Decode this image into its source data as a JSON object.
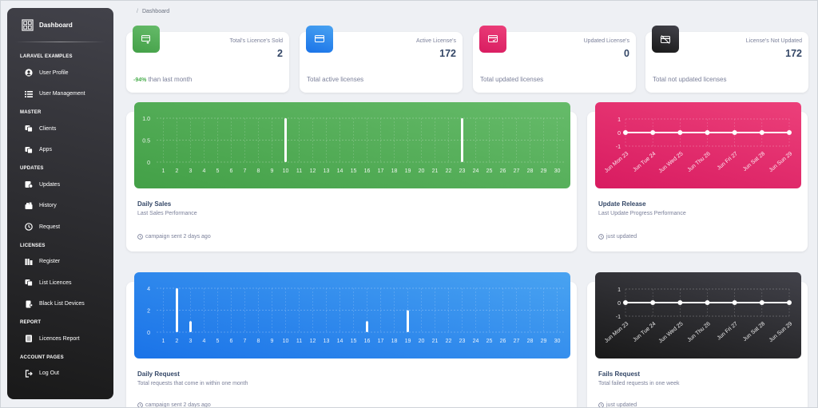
{
  "sidebar": {
    "brand": "Dashboard",
    "sections": [
      {
        "title": "LARAVEL EXAMPLES",
        "items": [
          {
            "label": "User Profile",
            "icon": "user-circle-icon"
          },
          {
            "label": "User Management",
            "icon": "list-icon"
          }
        ]
      },
      {
        "title": "MASTER",
        "items": [
          {
            "label": "Clients",
            "icon": "clients-icon"
          },
          {
            "label": "Apps",
            "icon": "apps-icon"
          }
        ]
      },
      {
        "title": "UPDATES",
        "items": [
          {
            "label": "Updates",
            "icon": "updates-icon"
          },
          {
            "label": "History",
            "icon": "history-icon"
          },
          {
            "label": "Request",
            "icon": "clock-icon"
          }
        ]
      },
      {
        "title": "LICENSES",
        "items": [
          {
            "label": "Register",
            "icon": "register-icon"
          },
          {
            "label": "List Licences",
            "icon": "list-licences-icon"
          },
          {
            "label": "Black List Devices",
            "icon": "blacklist-device-icon"
          }
        ]
      },
      {
        "title": "REPORT",
        "items": [
          {
            "label": "Licences Report",
            "icon": "report-icon"
          }
        ]
      },
      {
        "title": "ACCOUNT PAGES",
        "items": [
          {
            "label": "Log Out",
            "icon": "logout-icon"
          }
        ]
      }
    ]
  },
  "breadcrumb": {
    "separator": "/",
    "current": "Dashboard"
  },
  "stats": [
    {
      "label": "Total's Licence's Sold",
      "value": "2",
      "foot_strong": "-94%",
      "foot": " than last month",
      "color": "#4caf50",
      "icon": "license-add-icon"
    },
    {
      "label": "Active License's",
      "value": "172",
      "foot_strong": "",
      "foot": "Total active licenses",
      "color": "#1a73e8",
      "icon": "card-icon"
    },
    {
      "label": "Updated License's",
      "value": "0",
      "foot_strong": "",
      "foot": "Total updated licenses",
      "color": "#e91e63",
      "icon": "card-check-icon"
    },
    {
      "label": "License's Not Updated",
      "value": "172",
      "foot_strong": "",
      "foot": "Total not updated licenses",
      "color": "#262626",
      "icon": "card-off-icon"
    }
  ],
  "cards": {
    "daily_sales": {
      "title": "Daily Sales",
      "subtitle": "Last Sales Performance",
      "foot": "campaign sent 2 days ago"
    },
    "update_release": {
      "title": "Update Release",
      "subtitle": "Last Update Progress Performance",
      "foot": "just updated"
    },
    "daily_request": {
      "title": "Daily Request",
      "subtitle": "Total requests that come in within one month",
      "foot": "campaign sent 2 days ago"
    },
    "fails_request": {
      "title": "Fails Request",
      "subtitle": "Total failed requests in one week",
      "foot": "just updated"
    }
  },
  "chart_data": [
    {
      "id": "daily_sales",
      "type": "bar",
      "categories": [
        "1",
        "2",
        "3",
        "4",
        "5",
        "6",
        "7",
        "8",
        "9",
        "10",
        "11",
        "12",
        "13",
        "14",
        "15",
        "16",
        "17",
        "18",
        "19",
        "20",
        "21",
        "22",
        "23",
        "24",
        "25",
        "26",
        "27",
        "28",
        "29",
        "30"
      ],
      "values": [
        0,
        0,
        0,
        0,
        0,
        0,
        0,
        0,
        0,
        1,
        0,
        0,
        0,
        0,
        0,
        0,
        0,
        0,
        0,
        0,
        0,
        0,
        1,
        0,
        0,
        0,
        0,
        0,
        0,
        0
      ],
      "yticks": [
        "0",
        "0.5",
        "1.0"
      ],
      "ylim": [
        0,
        1
      ],
      "background": "#4caf50",
      "grid": true
    },
    {
      "id": "update_release",
      "type": "line",
      "categories": [
        "Jun Mon 23",
        "Jun Tue 24",
        "Jun Wed 25",
        "Jun Thu 26",
        "Jun Fri 27",
        "Jun Sat 28",
        "Jun Sun 29"
      ],
      "values": [
        0,
        0,
        0,
        0,
        0,
        0,
        0
      ],
      "yticks": [
        "-1",
        "0",
        "1"
      ],
      "ylim": [
        -1,
        1
      ],
      "background": "#e91e63",
      "grid": true
    },
    {
      "id": "daily_request",
      "type": "bar",
      "categories": [
        "1",
        "2",
        "3",
        "4",
        "5",
        "6",
        "7",
        "8",
        "9",
        "10",
        "11",
        "12",
        "13",
        "14",
        "15",
        "16",
        "17",
        "18",
        "19",
        "20",
        "21",
        "22",
        "23",
        "24",
        "25",
        "26",
        "27",
        "28",
        "29",
        "30"
      ],
      "values": [
        0,
        4,
        1,
        0,
        0,
        0,
        0,
        0,
        0,
        0,
        0,
        0,
        0,
        0,
        0,
        1,
        0,
        0,
        2,
        0,
        0,
        0,
        0,
        0,
        0,
        0,
        0,
        0,
        0,
        0
      ],
      "yticks": [
        "0",
        "2",
        "4"
      ],
      "ylim": [
        0,
        4
      ],
      "background": "#1a73e8",
      "grid": true
    },
    {
      "id": "fails_request",
      "type": "line",
      "categories": [
        "Jun Mon 23",
        "Jun Tue 24",
        "Jun Wed 25",
        "Jun Thu 26",
        "Jun Fri 27",
        "Jun Sat 28",
        "Jun Sun 29"
      ],
      "values": [
        0,
        0,
        0,
        0,
        0,
        0,
        0
      ],
      "yticks": [
        "-1",
        "0",
        "1"
      ],
      "ylim": [
        -1,
        1
      ],
      "background": "#262626",
      "grid": true
    }
  ]
}
